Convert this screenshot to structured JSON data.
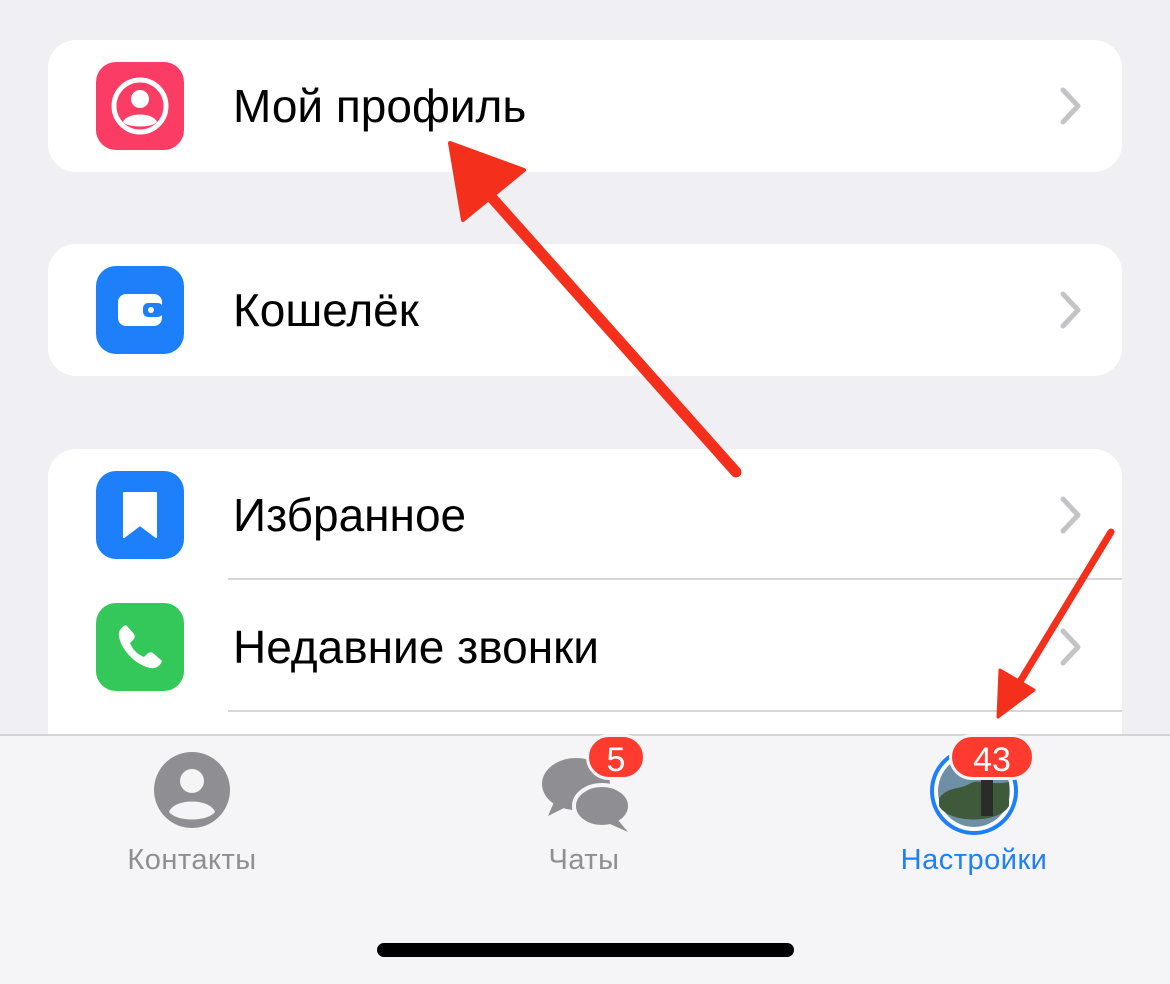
{
  "settings": {
    "profile": {
      "label": "Мой профиль",
      "icon": "person-circle-icon",
      "icon_color": "#fb3c64"
    },
    "wallet": {
      "label": "Кошелёк",
      "icon": "wallet-icon",
      "icon_color": "#1e7ffb"
    },
    "favorites": {
      "label": "Избранное",
      "icon": "bookmark-icon",
      "icon_color": "#1e7ffb"
    },
    "recent_calls": {
      "label": "Недавние звонки",
      "icon": "phone-icon",
      "icon_color": "#34c759"
    }
  },
  "tabbar": {
    "contacts": {
      "label": "Контакты",
      "icon": "person-circle-icon",
      "color": "#8e8e93"
    },
    "chats": {
      "label": "Чаты",
      "icon": "chat-bubbles-icon",
      "badge": "5",
      "color": "#8e8e93"
    },
    "settings": {
      "label": "Настройки",
      "icon": "avatar-photo",
      "badge": "43",
      "color": "#1e7ffb",
      "selected": true
    }
  },
  "annotations": {
    "arrow_color": "#f4301c"
  }
}
